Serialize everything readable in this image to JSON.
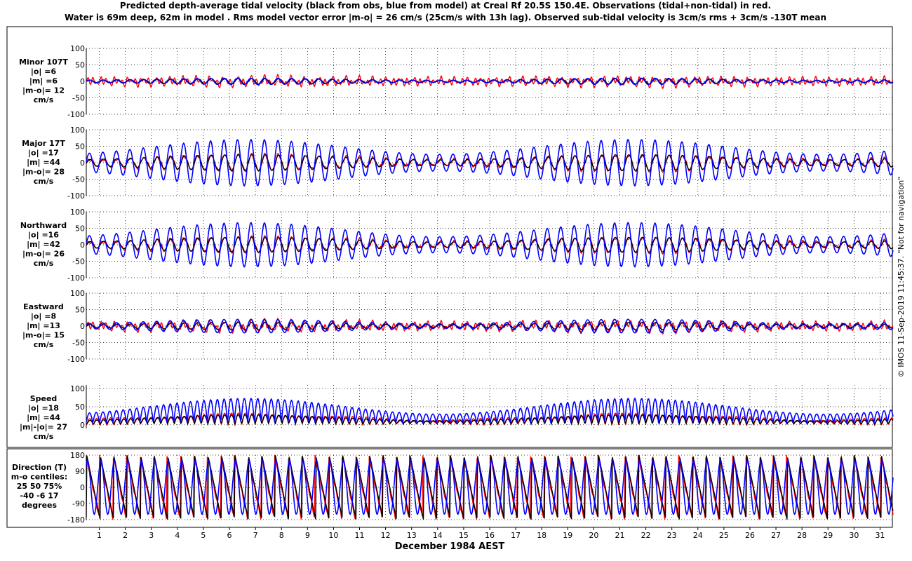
{
  "title": {
    "line1": "Predicted depth-average tidal velocity (black from obs, blue from model) at Creal Rf 20.5S 150.4E. Observations (tidal+non-tidal) in red.",
    "line2": "Water is 69m deep, 62m in model . Rms model vector error |m-o| = 26 cm/s (25cm/s with 13h lag). Observed sub-tidal velocity is 3cm/s rms + 3cm/s -130T mean"
  },
  "side_text": "© IMOS 11-Sep-2019 11:45:37. \"Not for navigation\"",
  "colors": {
    "obs_tidal": "#000000",
    "model": "#0000ff",
    "observed": "#ff0000",
    "grid": "#000000"
  },
  "chart_data": {
    "type": "line",
    "xlabel": "December 1984 AEST",
    "x_ticks": [
      "1",
      "2",
      "3",
      "4",
      "5",
      "6",
      "7",
      "8",
      "9",
      "10",
      "11",
      "12",
      "13",
      "14",
      "15",
      "16",
      "17",
      "18",
      "19",
      "20",
      "21",
      "22",
      "23",
      "24",
      "25",
      "26",
      "27",
      "28",
      "29",
      "30",
      "31"
    ],
    "xlim": [
      0.5,
      31.5
    ],
    "series_legend": [
      "black from obs",
      "blue from model",
      "Observations (tidal+non-tidal) in red"
    ],
    "panels": [
      {
        "key": "minor",
        "labels": [
          "Minor 107T",
          "|o| =6",
          "|m| =6",
          "|m-o|= 12",
          "cm/s"
        ],
        "ylim": [
          -100,
          100
        ],
        "yticks": [
          "100",
          "50",
          "0",
          "-50",
          "-100"
        ],
        "yvals": [
          100,
          50,
          0,
          -50,
          -100
        ],
        "obs_amp": 6,
        "model_amp": 6
      },
      {
        "key": "major",
        "labels": [
          "Major 17T",
          "|o| =17",
          "|m| =44",
          "|m-o|= 28",
          "cm/s"
        ],
        "ylim": [
          -100,
          100
        ],
        "yticks": [
          "100",
          "50",
          "0",
          "-50",
          "-100"
        ],
        "yvals": [
          100,
          50,
          0,
          -50,
          -100
        ],
        "obs_amp": 17,
        "model_amp": 44
      },
      {
        "key": "north",
        "labels": [
          "Northward",
          "|o| =16",
          "|m| =42",
          "|m-o|= 26",
          "cm/s"
        ],
        "ylim": [
          -100,
          100
        ],
        "yticks": [
          "100",
          "50",
          "0",
          "-50",
          "-100"
        ],
        "yvals": [
          100,
          50,
          0,
          -50,
          -100
        ],
        "obs_amp": 16,
        "model_amp": 42
      },
      {
        "key": "east",
        "labels": [
          "Eastward",
          "|o| =8",
          "|m| =13",
          "|m-o|= 15",
          "cm/s"
        ],
        "ylim": [
          -100,
          100
        ],
        "yticks": [
          "100",
          "50",
          "0",
          "-50",
          "-100"
        ],
        "yvals": [
          100,
          50,
          0,
          -50,
          -100
        ],
        "obs_amp": 8,
        "model_amp": 13
      },
      {
        "key": "speed",
        "labels": [
          "Speed",
          "|o| =18",
          "|m| =44",
          "|m|-|o|= 27",
          "cm/s"
        ],
        "ylim": [
          -10,
          110
        ],
        "yticks": [
          "100",
          "50",
          "0"
        ],
        "yvals": [
          100,
          50,
          0
        ],
        "obs_amp": 18,
        "model_amp": 44
      },
      {
        "key": "direction",
        "labels": [
          "Direction (T)",
          "m-o centiles:",
          "25  50  75%",
          "-40  -6  17",
          "degrees"
        ],
        "ylim": [
          -180,
          180
        ],
        "yticks": [
          "180",
          "90",
          "0",
          "-90",
          "-180"
        ],
        "yvals": [
          180,
          90,
          0,
          -90,
          -180
        ],
        "obs_amp": 0,
        "model_amp": 0
      }
    ]
  }
}
